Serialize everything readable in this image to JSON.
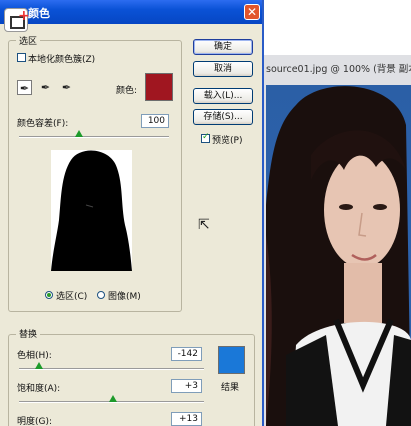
{
  "dialog": {
    "title": "颜色",
    "buttons": {
      "ok": "确定",
      "cancel": "取消",
      "load": "载入(L)...",
      "save": "存储(S)..."
    },
    "preview_checkbox": {
      "label": "预览(P)",
      "checked": true
    },
    "selection_group": {
      "label": "选区",
      "localized_clusters": {
        "label": "本地化颜色簇(Z)",
        "checked": false
      },
      "color_label": "颜色:",
      "picked_color": "#a01620",
      "fuzziness_label": "颜色容差(F):",
      "fuzziness_value": "100",
      "fuzziness_fraction": 0.4,
      "radio_selection": {
        "label": "选区(C)",
        "checked": true
      },
      "radio_image": {
        "label": "图像(M)",
        "checked": false
      }
    },
    "replace_group": {
      "label": "替换",
      "hue_label": "色相(H):",
      "hue_value": "-142",
      "saturation_label": "饱和度(A):",
      "saturation_value": "+3",
      "lightness_label": "明度(G):",
      "lightness_value": "+13",
      "result_label": "结果",
      "result_color": "#1a78d8"
    }
  },
  "document": {
    "title": "source01.jpg @ 100% (背景 副本,",
    "background_color": "#2d63ae"
  },
  "icons": {
    "app": "app-icon",
    "close": "close-icon",
    "eyedropper": "eyedropper-icon",
    "eyedropper_plus": "eyedropper-plus-icon",
    "eyedropper_minus": "eyedropper-minus-icon",
    "cursor": "mouse-cursor-icon"
  }
}
